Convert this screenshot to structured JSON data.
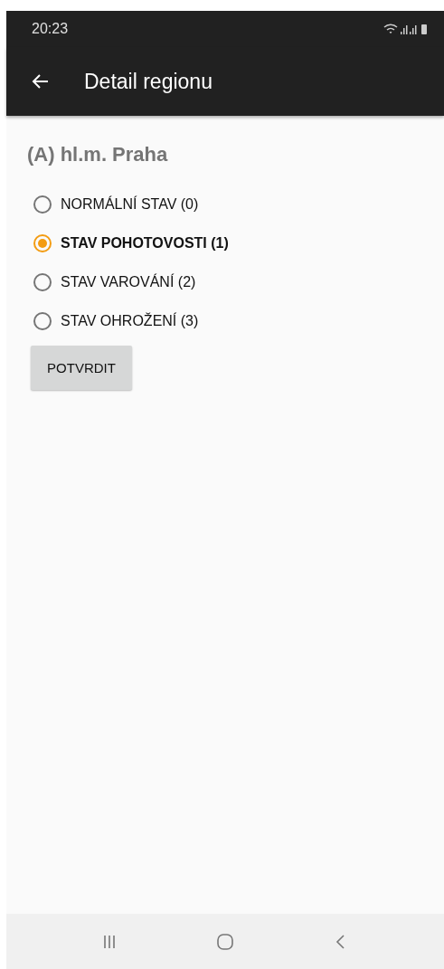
{
  "status_bar": {
    "time": "20:23"
  },
  "app_bar": {
    "title": "Detail regionu"
  },
  "region": {
    "title": "(A) hl.m. Praha"
  },
  "states": [
    {
      "label": "NORMÁLNÍ STAV (0)",
      "selected": false
    },
    {
      "label": "STAV POHOTOVOSTI (1)",
      "selected": true
    },
    {
      "label": "STAV VAROVÁNÍ (2)",
      "selected": false
    },
    {
      "label": "STAV OHROŽENÍ (3)",
      "selected": false
    }
  ],
  "confirm_button": {
    "label": "POTVRDIT"
  }
}
